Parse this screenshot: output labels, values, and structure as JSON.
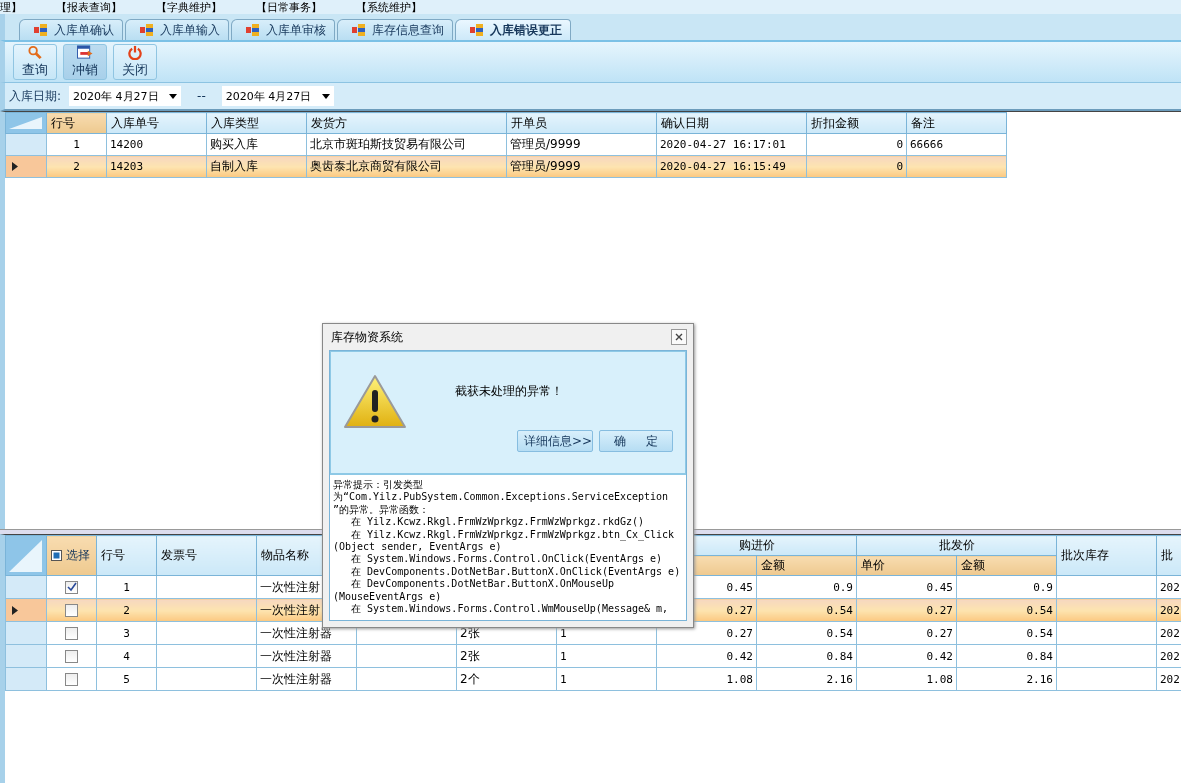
{
  "menu": [
    "理】",
    "【报表查询】",
    "【字典维护】",
    "【日常事务】",
    "【系统维护】"
  ],
  "tabs": [
    {
      "label": "入库单确认",
      "selected": false
    },
    {
      "label": "入库单输入",
      "selected": false
    },
    {
      "label": "入库单审核",
      "selected": false
    },
    {
      "label": "库存信息查询",
      "selected": false
    },
    {
      "label": "入库错误更正",
      "selected": true
    }
  ],
  "toolbar": [
    {
      "kind": "search",
      "label": "查询",
      "pressed": false
    },
    {
      "kind": "writeoff",
      "label": "冲销",
      "pressed": true
    },
    {
      "kind": "close",
      "label": "关闭",
      "pressed": false
    }
  ],
  "filter": {
    "label": "入库日期:",
    "from": "2020年 4月27日",
    "separator": "--",
    "to": "2020年 4月27日"
  },
  "orders": {
    "columns": [
      "行号",
      "入库单号",
      "入库类型",
      "发货方",
      "开单员",
      "确认日期",
      "折扣金额",
      "备注"
    ],
    "rows": [
      {
        "selected": false,
        "line": "1",
        "order_no": "14200",
        "type": "购买入库",
        "supplier": "北京市斑珀斯技贸易有限公司",
        "clerk": "管理员/9999",
        "confirmed": "2020-04-27 16:17:01",
        "discount": "0",
        "remark": "66666"
      },
      {
        "selected": true,
        "line": "2",
        "order_no": "14203",
        "type": "自制入库",
        "supplier": "奥齿泰北京商贸有限公司",
        "clerk": "管理员/9999",
        "confirmed": "2020-04-27 16:15:49",
        "discount": "0"
      }
    ]
  },
  "items": {
    "header": {
      "select": "选择",
      "line": "行号",
      "invoice": "发票号",
      "item": "物品名称",
      "buy_group": "购进价",
      "buy_amount": "金额",
      "sale_group": "批发价",
      "sale_price": "单价",
      "sale_amount": "金额",
      "batch_stock": "批次库存",
      "batch_no": "批"
    },
    "select_all_indeterminate": true,
    "rows": [
      {
        "checked": true,
        "selected": false,
        "line": "1",
        "item": "一次性注射",
        "buy_price": "0.45",
        "buy_amount": "0.9",
        "sale_price": "0.45",
        "sale_amount": "0.9",
        "batch_no": "202"
      },
      {
        "checked": false,
        "selected": true,
        "line": "2",
        "item": "一次性注射",
        "buy_price": "0.27",
        "buy_amount": "0.54",
        "sale_price": "0.27",
        "sale_amount": "0.54",
        "batch_no": "202"
      },
      {
        "checked": false,
        "selected": false,
        "line": "3",
        "item": "一次性注射器",
        "column_7": "2张",
        "column_8": "1",
        "buy_price": "0.27",
        "buy_amount": "0.54",
        "sale_price": "0.27",
        "sale_amount": "0.54",
        "batch_no": "202"
      },
      {
        "checked": false,
        "selected": false,
        "line": "4",
        "item": "一次性注射器",
        "column_7": "2张",
        "column_8": "1",
        "buy_price": "0.42",
        "buy_amount": "0.84",
        "sale_price": "0.42",
        "sale_amount": "0.84",
        "batch_no": "202"
      },
      {
        "checked": false,
        "selected": false,
        "line": "5",
        "item": "一次性注射器",
        "column_7": "2个",
        "column_8": "1",
        "buy_price": "1.08",
        "buy_amount": "2.16",
        "sale_price": "1.08",
        "sale_amount": "2.16",
        "batch_no": "202"
      }
    ]
  },
  "dialog": {
    "title": "库存物资系统",
    "message": "截获未处理的异常！",
    "buttons": [
      "详细信息>>",
      "确     定"
    ],
    "details": [
      "异常提示：引发类型",
      "为“Com.Yilz.PubSystem.Common.Exceptions.ServiceException",
      "”的异常。异常函数：",
      "   在 Yilz.Kcwz.Rkgl.FrmWzWprkgz.FrmWzWprkgz.rkdGz()",
      "   在 Yilz.Kcwz.Rkgl.FrmWzWprkgz.FrmWzWprkgz.btn_Cx_Click",
      "(Object sender, EventArgs e)",
      "   在 System.Windows.Forms.Control.OnClick(EventArgs e)",
      "   在 DevComponents.DotNetBar.ButtonX.OnClick(EventArgs e)",
      "   在 DevComponents.DotNetBar.ButtonX.OnMouseUp",
      "(MouseEventArgs e)",
      "   在 System.Windows.Forms.Control.WmMouseUp(Message& m,"
    ]
  }
}
